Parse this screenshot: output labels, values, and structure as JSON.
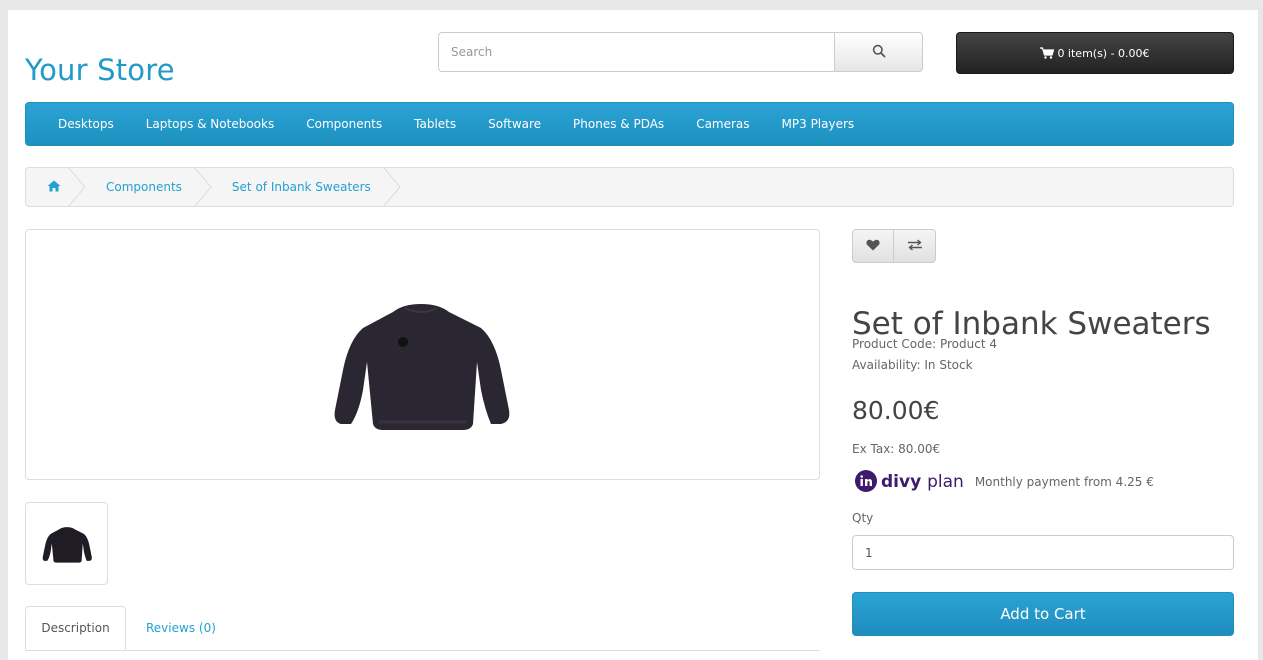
{
  "header": {
    "logo": "Your Store",
    "search_placeholder": "Search",
    "cart_label": "0 item(s) - 0.00€"
  },
  "menu": {
    "items": [
      "Desktops",
      "Laptops & Notebooks",
      "Components",
      "Tablets",
      "Software",
      "Phones & PDAs",
      "Cameras",
      "MP3 Players"
    ]
  },
  "breadcrumb": {
    "items": [
      "Components",
      "Set of Inbank Sweaters"
    ]
  },
  "product": {
    "title": "Set of Inbank Sweaters",
    "product_code": "Product Code: Product 4",
    "availability": "Availability: In Stock",
    "price": "80.00€",
    "ex_tax": "Ex Tax: 80.00€",
    "divy_brand": "divy",
    "divy_plan": "plan",
    "divy_monthly": "Monthly payment from 4.25 €",
    "qty_label": "Qty",
    "qty_value": "1",
    "add_to_cart": "Add to Cart"
  },
  "tabs": {
    "description": "Description",
    "reviews": "Reviews (0)"
  },
  "colors": {
    "brand_blue": "#229ac8",
    "divy_purple": "#3d1a6b",
    "sweater": "#2a2733"
  },
  "icons": {
    "search": "search-icon",
    "cart": "cart-icon",
    "home": "home-icon",
    "wishlist": "heart-icon",
    "compare": "exchange-icon"
  }
}
